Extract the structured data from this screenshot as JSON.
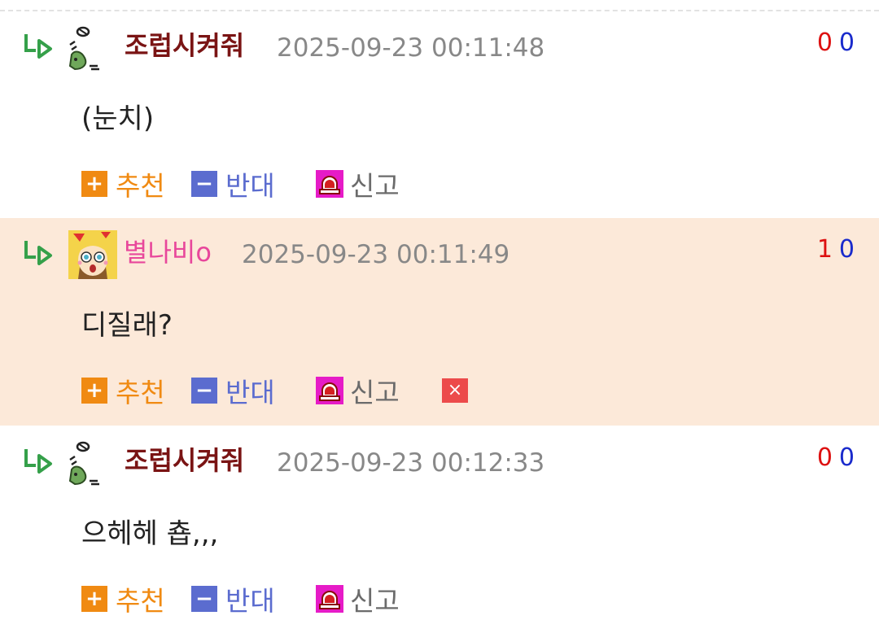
{
  "comments": [
    {
      "nickname": "조럽시켜줘",
      "datetime": "2025-09-23 00:11:48",
      "upvotes": "0",
      "downvotes": "0",
      "text": "(눈치)",
      "avatar": "frog-icon"
    },
    {
      "nickname": "별나비o",
      "datetime": "2025-09-23 00:11:49",
      "upvotes": "1",
      "downvotes": "0",
      "text": "디질래?",
      "avatar": "cartoon-girl-avatar"
    },
    {
      "nickname": "조럽시켜줘",
      "datetime": "2025-09-23 00:12:33",
      "upvotes": "0",
      "downvotes": "0",
      "text": "으헤헤 춉,,,",
      "avatar": "frog-icon"
    }
  ],
  "actions": {
    "recommend_label": "추천",
    "oppose_label": "반대",
    "report_label": "신고",
    "plus_symbol": "+",
    "minus_symbol": "−",
    "delete_symbol": "×"
  },
  "colors": {
    "highlight_row": "#fce9d9",
    "nickname": "#7a1414",
    "nickname_pink": "#e8479b",
    "recommend": "#f08a12",
    "oppose": "#5b6ccf",
    "report": "#e61bc7",
    "upvote": "#dd1111",
    "downvote": "#1a2bcc"
  }
}
